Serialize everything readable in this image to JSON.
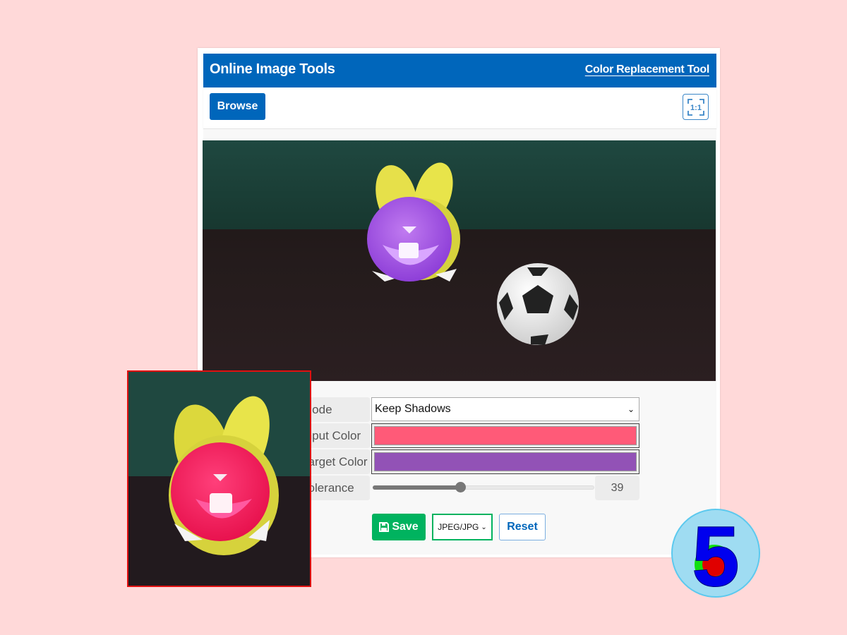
{
  "header": {
    "title": "Online Image Tools",
    "tool_link": "Color Replacement Tool"
  },
  "toolbar": {
    "browse_label": "Browse",
    "ratio_icon_text": "1:1"
  },
  "controls": {
    "mode": {
      "label": "Mode",
      "value": "Keep Shadows"
    },
    "input_color": {
      "label": "Input Color",
      "value": "#ff5a78"
    },
    "target_color": {
      "label": "Target Color",
      "value": "#9252b6"
    },
    "tolerance": {
      "label": "Tolerance",
      "value": "39",
      "fraction": 0.39
    }
  },
  "actions": {
    "save_label": "Save",
    "format_value": "JPEG/JPG",
    "reset_label": "Reset"
  },
  "colors": {
    "brand_blue": "#0066bb",
    "save_green": "#00b35f",
    "preview_border": "#e01010",
    "background": "#ffd9d9"
  },
  "images": {
    "main_photo": "bunny toy (purple face) and soccer ball on dark table",
    "preview_photo": "bunny toy with face recolored pink"
  },
  "logo": {
    "text": "5"
  }
}
